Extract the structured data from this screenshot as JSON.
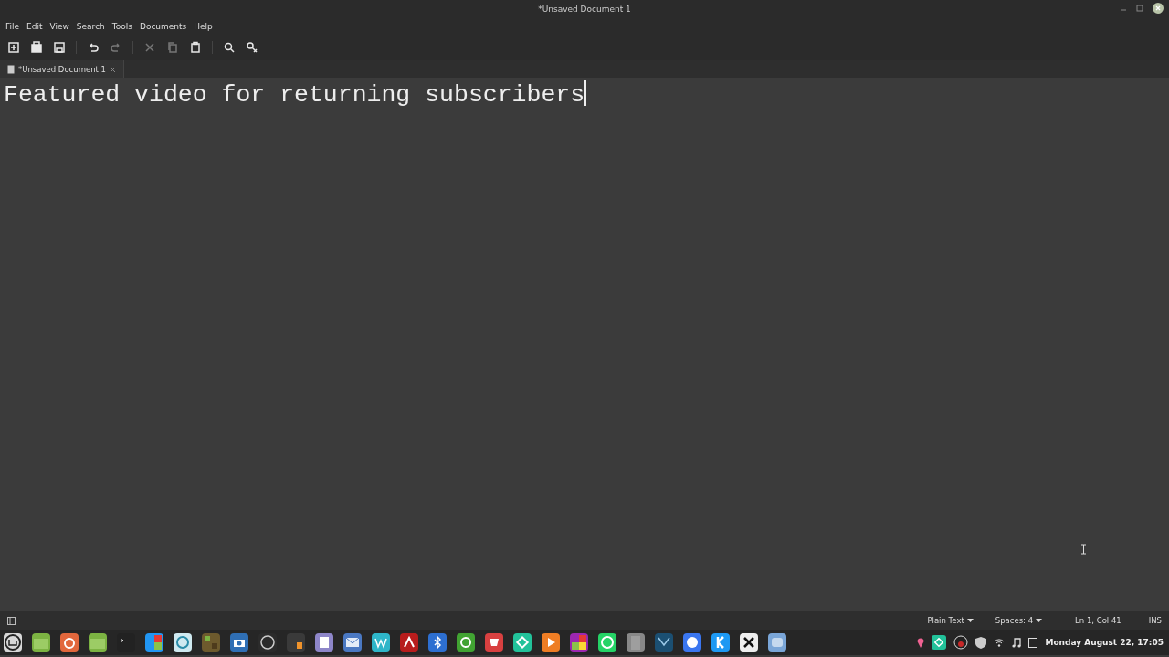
{
  "window": {
    "title": "*Unsaved Document 1"
  },
  "menu": [
    "File",
    "Edit",
    "View",
    "Search",
    "Tools",
    "Documents",
    "Help"
  ],
  "tabs": [
    {
      "label": "*Unsaved Document 1",
      "selected": true
    }
  ],
  "editor": {
    "text": "Featured video for returning subscribers"
  },
  "status_bar": {
    "language": "Plain Text",
    "indent": "Spaces: 4",
    "position": "Ln 1, Col 41",
    "mode": "INS"
  },
  "taskbar": {
    "clock": "Monday August 22, 17:05"
  }
}
